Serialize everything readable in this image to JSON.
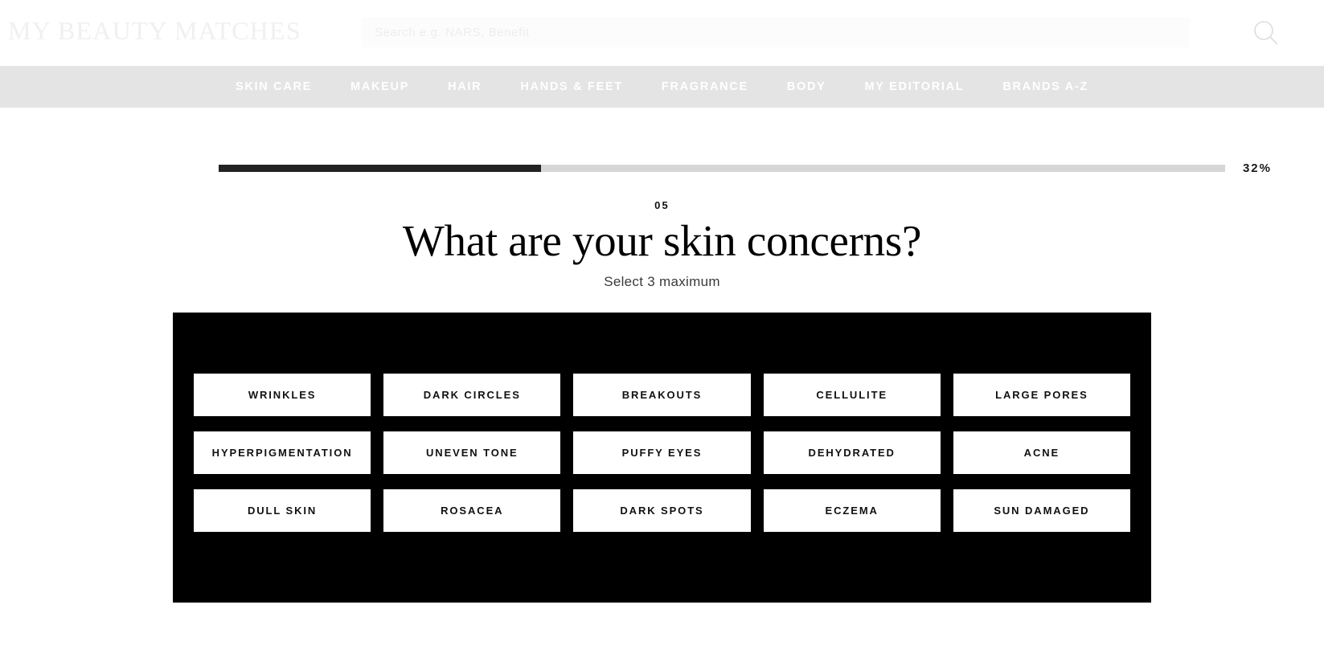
{
  "header": {
    "logo": "MY BEAUTY MATCHES",
    "search": {
      "placeholder": "Search e.g. NARS, Benefit",
      "value": "",
      "icon": "search-icon"
    }
  },
  "nav": {
    "items": [
      {
        "label": "SKIN CARE"
      },
      {
        "label": "MAKEUP"
      },
      {
        "label": "HAIR"
      },
      {
        "label": "HANDS & FEET"
      },
      {
        "label": "FRAGRANCE"
      },
      {
        "label": "BODY"
      },
      {
        "label": "MY EDITORIAL"
      },
      {
        "label": "BRANDS A-Z"
      }
    ]
  },
  "progress": {
    "percent_label": "32%",
    "percent_value": 32,
    "fill_color": "#222222",
    "track_color": "#d6d6d6"
  },
  "question": {
    "step": "05",
    "title": "What are your skin concerns?",
    "subtitle": "Select 3 maximum"
  },
  "options": {
    "panel_color": "#000000",
    "items": [
      {
        "label": "WRINKLES"
      },
      {
        "label": "DARK CIRCLES"
      },
      {
        "label": "BREAKOUTS"
      },
      {
        "label": "CELLULITE"
      },
      {
        "label": "LARGE PORES"
      },
      {
        "label": "HYPERPIGMENTATION"
      },
      {
        "label": "UNEVEN TONE"
      },
      {
        "label": "PUFFY EYES"
      },
      {
        "label": "DEHYDRATED"
      },
      {
        "label": "ACNE"
      },
      {
        "label": "DULL SKIN"
      },
      {
        "label": "ROSACEA"
      },
      {
        "label": "DARK SPOTS"
      },
      {
        "label": "ECZEMA"
      },
      {
        "label": "SUN DAMAGED"
      }
    ]
  }
}
